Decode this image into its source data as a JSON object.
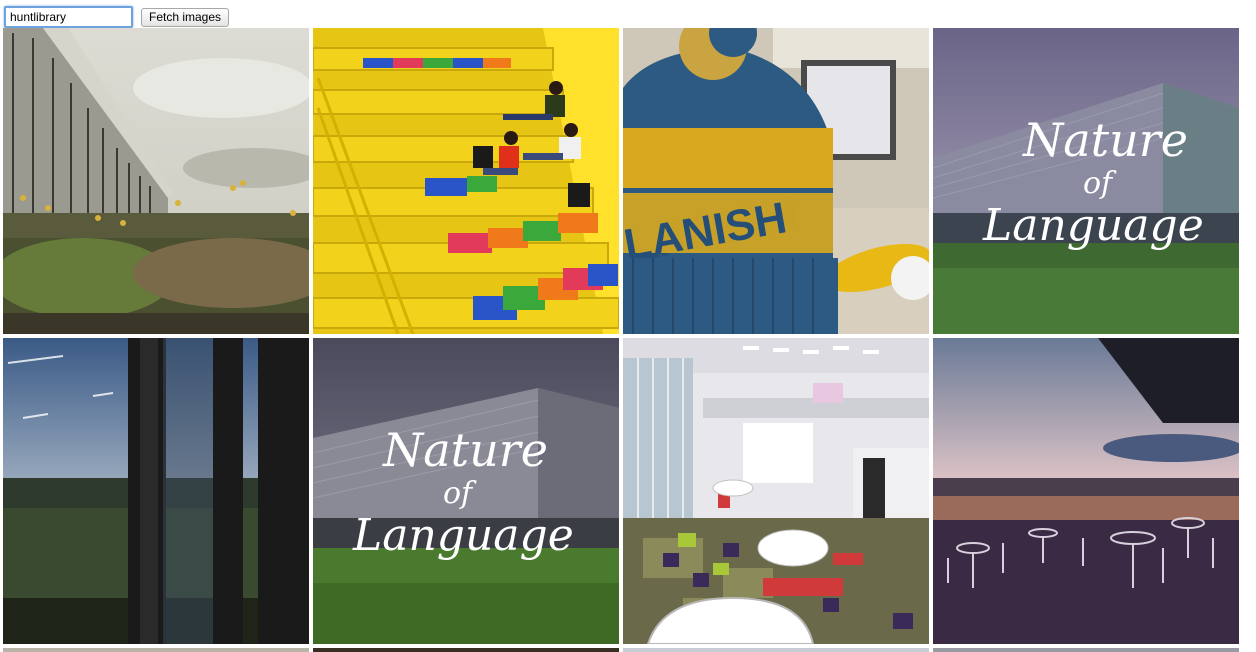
{
  "search": {
    "value": "huntlibrary"
  },
  "toolbar": {
    "fetch_label": "Fetch images"
  },
  "images": [
    {
      "subject": "building-facade-garden-photo"
    },
    {
      "subject": "yellow-staircase-students-photo"
    },
    {
      "subject": "knit-hat-photo",
      "knit_text": "LANISH"
    },
    {
      "subject": "nature-of-language-building-photo",
      "overlay_text": [
        "Nature",
        "of",
        "Language"
      ]
    },
    {
      "subject": "window-sunset-view-photo"
    },
    {
      "subject": "nature-of-language-building-photo",
      "overlay_text": [
        "Nature",
        "of",
        "Language"
      ]
    },
    {
      "subject": "library-atrium-photo"
    },
    {
      "subject": "terrace-sunset-photo"
    }
  ]
}
